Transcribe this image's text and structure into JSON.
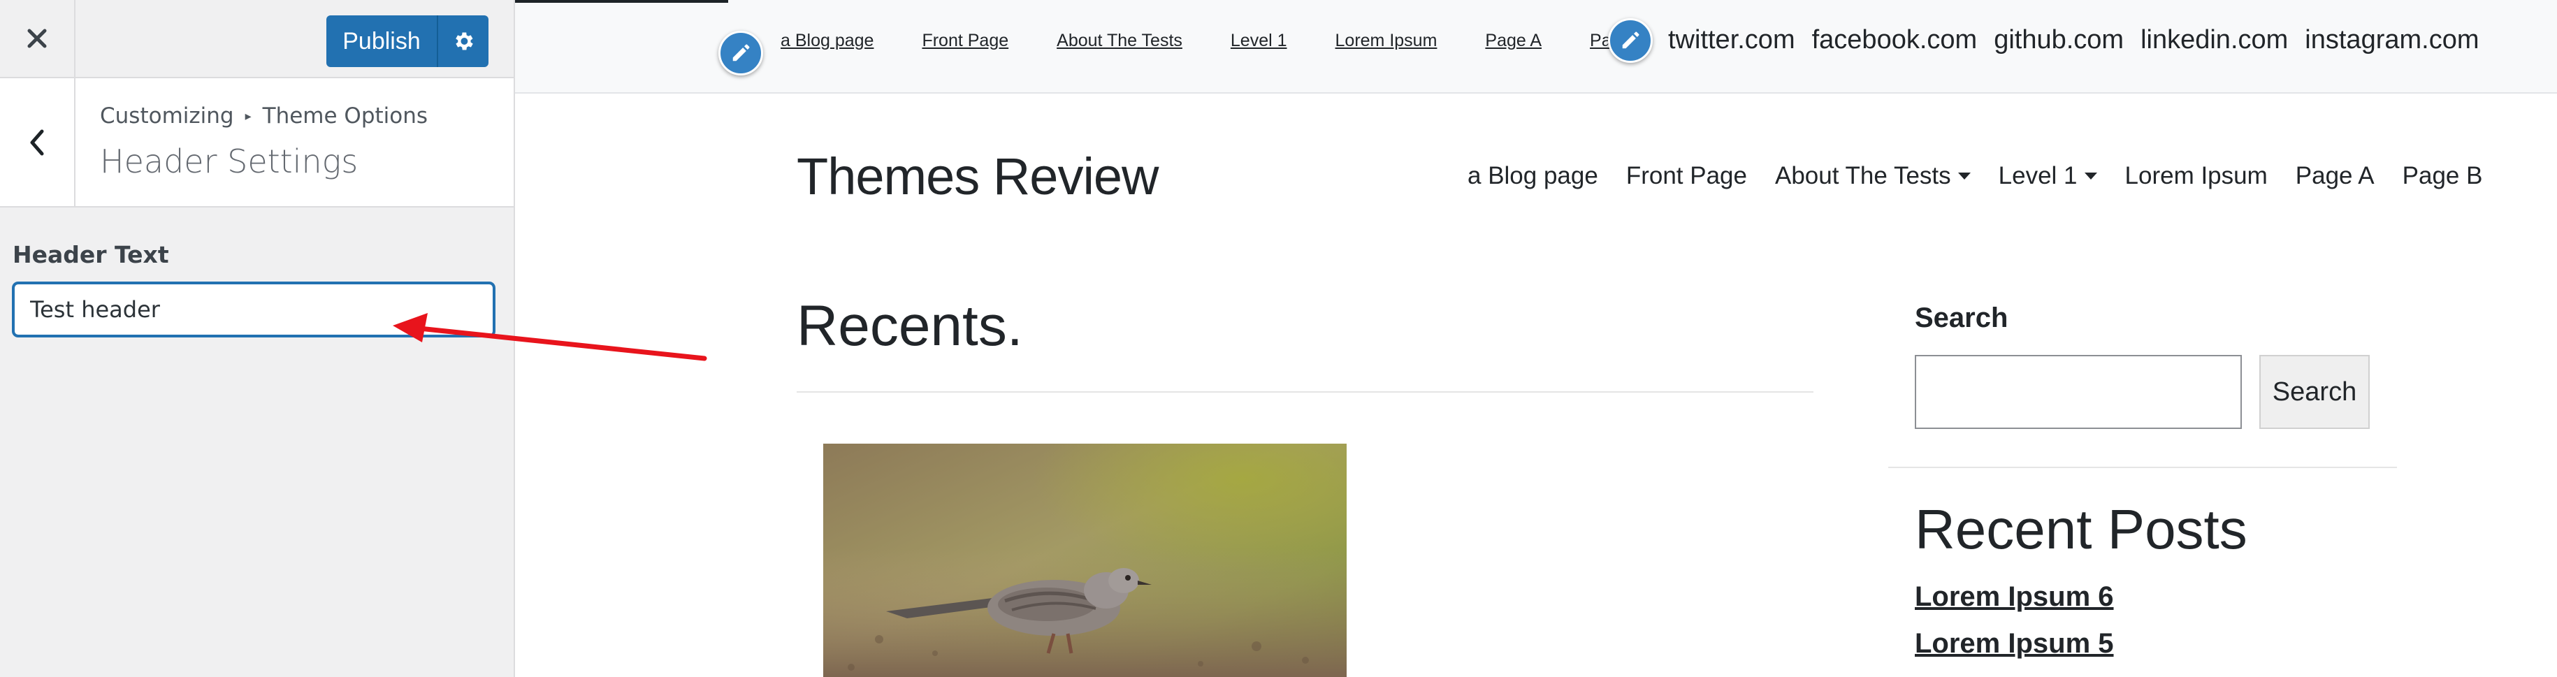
{
  "customizer": {
    "publish_label": "Publish",
    "breadcrumb": [
      "Customizing",
      "Theme Options"
    ],
    "section_title": "Header Settings",
    "field_label": "Header Text",
    "field_value": "Test header",
    "colors": {
      "primary": "#2271b1",
      "panel_bg": "#f0f0f1"
    }
  },
  "preview": {
    "top_menu": [
      "a Blog page",
      "Front Page",
      "About The Tests",
      "Level 1",
      "Lorem Ipsum",
      "Page A",
      "Page B"
    ],
    "social_links": [
      "twitter.com",
      "facebook.com",
      "github.com",
      "linkedin.com",
      "instagram.com"
    ],
    "site_title": "Themes Review",
    "main_nav": [
      {
        "label": "a Blog page",
        "has_dropdown": false
      },
      {
        "label": "Front Page",
        "has_dropdown": false
      },
      {
        "label": "About The Tests",
        "has_dropdown": true
      },
      {
        "label": "Level 1",
        "has_dropdown": true
      },
      {
        "label": "Lorem Ipsum",
        "has_dropdown": false
      },
      {
        "label": "Page A",
        "has_dropdown": false
      },
      {
        "label": "Page B",
        "has_dropdown": false
      }
    ],
    "recents_title": "Recents.",
    "sidebar": {
      "search_label": "Search",
      "search_button": "Search",
      "recent_posts_title": "Recent Posts",
      "recent_posts": [
        "Lorem Ipsum 6",
        "Lorem Ipsum 5"
      ]
    }
  },
  "icons": {
    "close": "close-icon",
    "settings": "gear-icon",
    "back": "chevron-left-icon",
    "edit": "pencil-icon",
    "arrow_color": "#e8141c"
  }
}
